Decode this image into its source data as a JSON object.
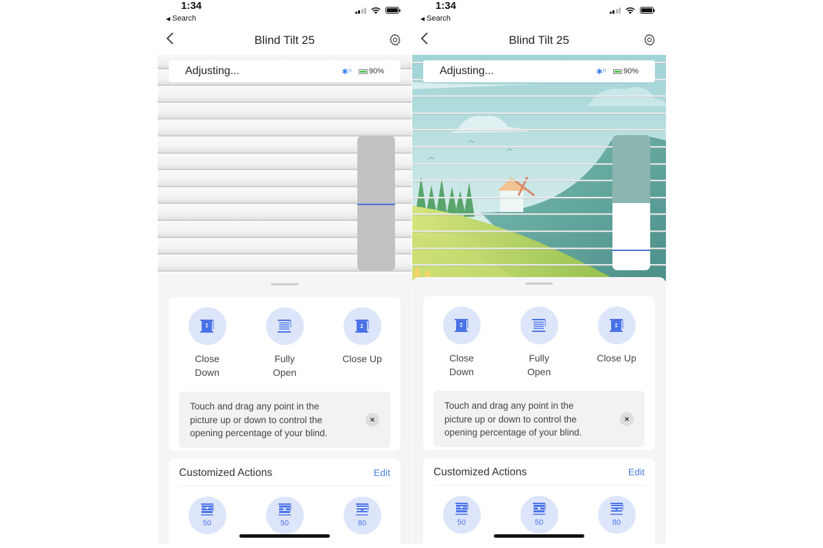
{
  "screens": [
    {
      "id": "left",
      "status_bar": {
        "time": "1:34",
        "back_label": "Search"
      },
      "nav": {
        "title": "Blind Tilt 25"
      },
      "device_status": {
        "state": "Adjusting...",
        "battery": "90%"
      },
      "scene": "closed-slats",
      "slider": {
        "indicator_position_pct": 50,
        "open_fraction": 0
      },
      "actions": [
        {
          "label": "Close Down",
          "icon": "close-down-icon"
        },
        {
          "label": "Fully Open",
          "icon": "fully-open-icon"
        },
        {
          "label": "Close Up",
          "icon": "close-up-icon"
        }
      ],
      "tip": {
        "text": "Touch and drag any point in the picture up or down to control the opening percentage of your blind."
      },
      "customized": {
        "title": "Customized Actions",
        "edit_label": "Edit",
        "presets": [
          {
            "value": "50",
            "icon": "tilt-down-preset-icon"
          },
          {
            "value": "50",
            "icon": "tilt-up-preset-icon"
          },
          {
            "value": "80",
            "icon": "tilt-down-preset-icon"
          }
        ]
      }
    },
    {
      "id": "right",
      "status_bar": {
        "time": "1:34",
        "back_label": "Search"
      },
      "nav": {
        "title": "Blind Tilt 25"
      },
      "device_status": {
        "state": "Adjusting...",
        "battery": "90%"
      },
      "scene": "open-landscape",
      "slider": {
        "indicator_position_pct": 85,
        "open_fraction": 0.5
      },
      "actions": [
        {
          "label": "Close Down",
          "icon": "close-down-icon"
        },
        {
          "label": "Fully Open",
          "icon": "fully-open-icon"
        },
        {
          "label": "Close Up",
          "icon": "close-up-icon"
        }
      ],
      "tip": {
        "text": "Touch and drag any point in the picture up or down to control the opening percentage of your blind."
      },
      "customized": {
        "title": "Customized Actions",
        "edit_label": "Edit",
        "presets": [
          {
            "value": "50",
            "icon": "tilt-down-preset-icon"
          },
          {
            "value": "50",
            "icon": "tilt-up-preset-icon"
          },
          {
            "value": "80",
            "icon": "tilt-down-preset-icon"
          }
        ]
      }
    }
  ],
  "colors": {
    "accent": "#4a73e8",
    "icon_bg": "#dde5fa",
    "link": "#4a7fe0",
    "battery_green": "#4cc44c",
    "sky": "#a9d8db"
  }
}
